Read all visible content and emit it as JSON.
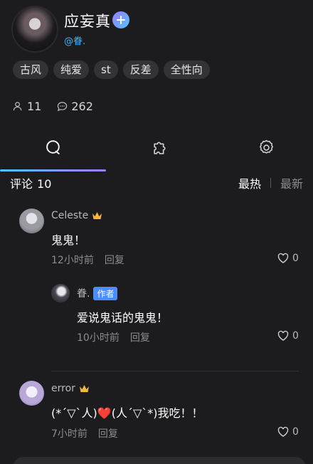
{
  "profile": {
    "name": "应妄真",
    "handle": "@眷."
  },
  "tags": [
    "古风",
    "纯爱",
    "st",
    "反差",
    "全性向"
  ],
  "stats": {
    "followers": "11",
    "comments": "262"
  },
  "tabs": [
    {
      "icon": "search-icon"
    },
    {
      "icon": "puzzle-icon"
    },
    {
      "icon": "gear-icon"
    }
  ],
  "comments_header": {
    "title": "评论",
    "count": "10",
    "sort_hot": "最热",
    "sort_new": "最新"
  },
  "comments": [
    {
      "user": "Celeste",
      "text": "鬼鬼！",
      "time": "12小时前",
      "reply": "回复",
      "likes": "0"
    },
    {
      "user": "眷.",
      "badge": "作者",
      "text": "爱说鬼话的鬼鬼！",
      "time": "10小时前",
      "reply": "回复",
      "likes": "0"
    },
    {
      "user": "error",
      "text": "(*´▽`人)❤️(人´▽`*)我吃！！",
      "time": "7小时前",
      "reply": "回复",
      "likes": "0"
    }
  ],
  "colors": {
    "background": "#1c1c1e",
    "accent_blue": "#3db4ff",
    "gradient_start": "#4fc6ff",
    "gradient_end": "#a07bff",
    "crown": "#f5b83d"
  }
}
